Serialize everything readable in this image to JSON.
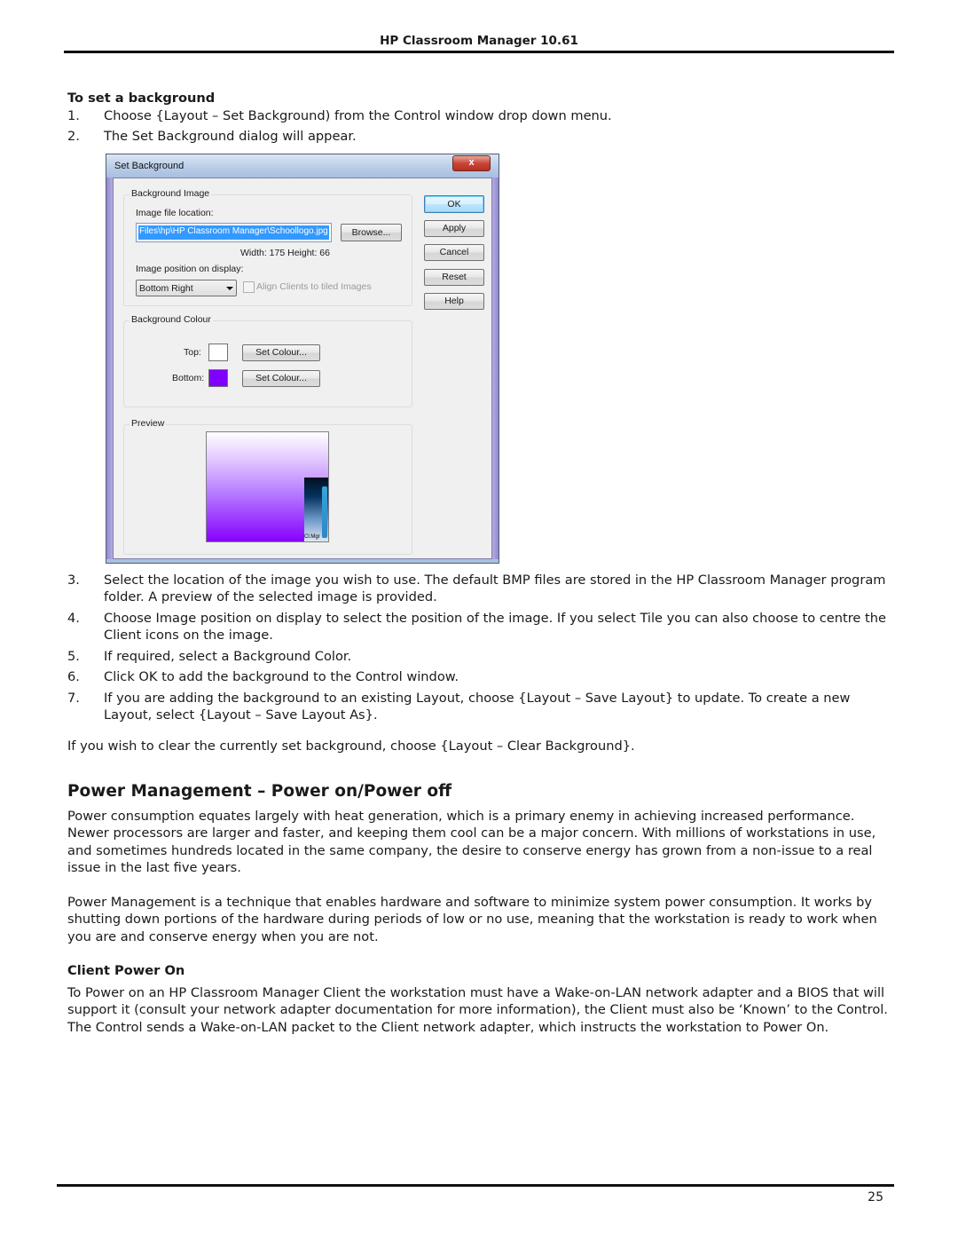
{
  "header": {
    "title": "HP Classroom Manager 10.61"
  },
  "set_background": {
    "heading": "To set a background",
    "steps_before": [
      {
        "num": "1.",
        "text": "Choose {Layout – Set Background) from the Control window drop down menu."
      },
      {
        "num": "2.",
        "text": "The Set Background dialog will appear."
      }
    ],
    "steps_after": [
      {
        "num": "3.",
        "text": "Select the location of the image you wish to use. The default BMP files are stored in the HP Classroom Manager program folder. A preview of the selected image is provided."
      },
      {
        "num": "4.",
        "text": "Choose Image position on display to select the position of the image. If you select Tile you can also choose to centre the Client icons on the image."
      },
      {
        "num": "5.",
        "text": "If required, select a Background Color."
      },
      {
        "num": "6.",
        "text": "Click OK to add the background to the Control window."
      },
      {
        "num": "7.",
        "text": "If you are adding the background to an existing Layout, choose {Layout – Save Layout} to update. To create a new Layout, select {Layout – Save Layout As}."
      }
    ],
    "clear_note": "If you wish to clear the currently set background, choose {Layout – Clear Background}."
  },
  "dialog": {
    "title": "Set Background",
    "close_label": "x",
    "background_image": {
      "group_label": "Background Image",
      "file_location_label": "Image file location:",
      "file_location_value": "Files\\hp\\HP Classroom Manager\\Schoollogo.jpg",
      "browse_label": "Browse...",
      "dimensions": "Width: 175   Height: 66",
      "position_label": "Image position on display:",
      "position_value": "Bottom Right",
      "align_checkbox_label": "Align Clients to tiled Images",
      "align_checked": false
    },
    "background_colour": {
      "group_label": "Background Colour",
      "top_label": "Top:",
      "top_color": "#ffffff",
      "bottom_label": "Bottom:",
      "bottom_color": "#8000ff",
      "set_colour_label": "Set Colour..."
    },
    "preview": {
      "group_label": "Preview",
      "logo_text": "Cl.Mgr"
    },
    "buttons": {
      "ok": "OK",
      "apply": "Apply",
      "cancel": "Cancel",
      "reset": "Reset",
      "help": "Help"
    }
  },
  "power_management": {
    "title": "Power Management – Power on/Power off",
    "paragraphs": [
      "Power consumption equates largely with heat generation, which is a primary enemy in achieving increased performance. Newer processors are larger and faster, and keeping them cool can be a major concern. With millions of workstations in use, and sometimes hundreds located in the same company, the desire to conserve energy has grown from a non-issue to a real issue in the last five years.",
      "Power Management is a technique that enables hardware and software to minimize system power consumption. It works by shutting down portions of the hardware during periods of low or no use, meaning that the workstation is ready to work when you are and conserve energy when you are not."
    ],
    "client_power_on": {
      "heading": "Client Power On",
      "text": "To Power on an HP Classroom Manager Client the workstation must have a Wake-on-LAN network adapter and a BIOS that will support it (consult your network adapter documentation for more information), the Client must also be ‘Known’ to the Control. The Control sends a Wake-on-LAN packet to the Client network adapter, which instructs the workstation to Power On."
    }
  },
  "footer": {
    "page_number": "25"
  }
}
